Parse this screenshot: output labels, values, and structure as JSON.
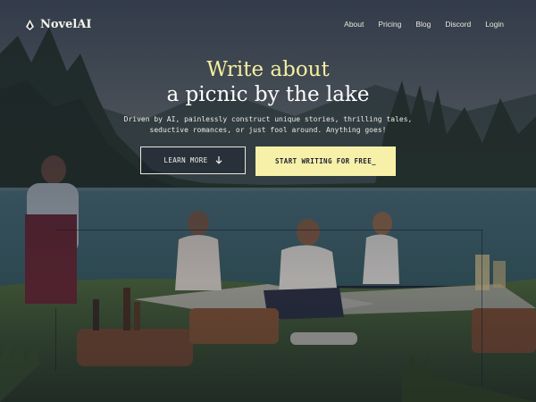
{
  "brand": {
    "name": "NovelAI",
    "logo_icon": "quill-icon"
  },
  "nav": {
    "links": [
      "About",
      "Pricing",
      "Blog",
      "Discord",
      "Login"
    ]
  },
  "hero": {
    "headline_line1": "Write about",
    "headline_line2": "a picnic by the lake",
    "subtext_line1": "Driven by AI, painlessly construct unique stories, thrilling tales,",
    "subtext_line2": "seductive romances, or just fool around. Anything goes!",
    "learn_more_label": "LEARN MORE",
    "learn_more_icon": "arrow-down-icon",
    "start_writing_label": "START WRITING FOR FREE_"
  },
  "colors": {
    "accent_yellow": "#f5ef9e",
    "button_yellow": "#f7f0a8",
    "overlay_navy": "#141a2a"
  }
}
